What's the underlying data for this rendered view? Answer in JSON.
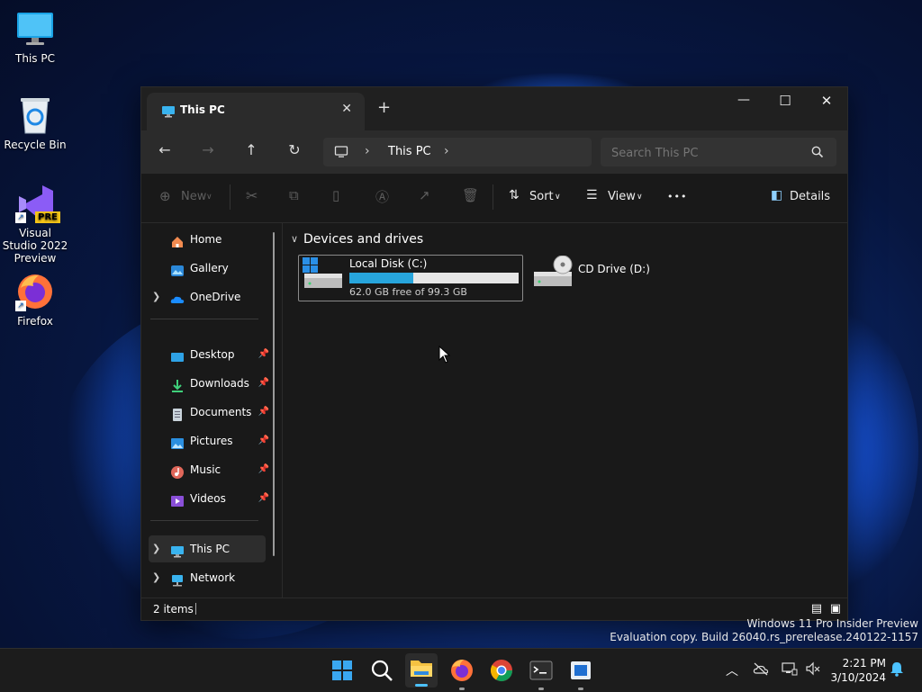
{
  "desktop": {
    "icons": [
      {
        "label": "This PC"
      },
      {
        "label": "Recycle Bin"
      },
      {
        "label": "Visual Studio 2022 Preview",
        "badge": "PRE"
      },
      {
        "label": "Firefox"
      }
    ]
  },
  "window": {
    "tab_title": "This PC",
    "tab_close": "✕",
    "new_tab": "+",
    "controls": {
      "minimize": "—",
      "maximize": "☐",
      "close": "✕"
    },
    "nav": {
      "back": "←",
      "forward": "→",
      "up": "↑",
      "refresh": "↻"
    },
    "breadcrumb": {
      "root_sep": "›",
      "current": "This PC",
      "trail_sep": "›"
    },
    "search": {
      "placeholder": "Search This PC",
      "icon": "search-icon"
    },
    "toolbar": {
      "new_label": "New",
      "sort_label": "Sort",
      "view_label": "View",
      "more_label": "•••",
      "details_label": "Details"
    },
    "nav_pane": {
      "items": [
        {
          "label": "Home",
          "icon": "home-icon"
        },
        {
          "label": "Gallery",
          "icon": "gallery-icon"
        },
        {
          "label": "OneDrive",
          "icon": "onedrive-icon",
          "expandable": true
        },
        {
          "label": "Desktop",
          "icon": "desktop-icon",
          "pinned": true
        },
        {
          "label": "Downloads",
          "icon": "downloads-icon",
          "pinned": true
        },
        {
          "label": "Documents",
          "icon": "documents-icon",
          "pinned": true
        },
        {
          "label": "Pictures",
          "icon": "pictures-icon",
          "pinned": true
        },
        {
          "label": "Music",
          "icon": "music-icon",
          "pinned": true
        },
        {
          "label": "Videos",
          "icon": "videos-icon",
          "pinned": true
        },
        {
          "label": "This PC",
          "icon": "this-pc-icon",
          "expandable": true,
          "selected": true
        },
        {
          "label": "Network",
          "icon": "network-icon",
          "expandable": true
        }
      ]
    },
    "content": {
      "group_title": "Devices and drives",
      "group_chevron": "∨",
      "drives": [
        {
          "name": "Local Disk (C:)",
          "free_text": "62.0 GB free of 99.3 GB",
          "used_fraction": 0.376
        },
        {
          "name": "CD Drive (D:)"
        }
      ]
    },
    "status": {
      "items_text": "2 items"
    }
  },
  "watermark": {
    "line1": "Windows 11 Pro Insider Preview",
    "line2": "Evaluation copy. Build 26040.rs_prerelease.240122-1157"
  },
  "taskbar": {
    "clock_time": "2:21 PM",
    "clock_date": "3/10/2024"
  },
  "colors": {
    "accent": "#4cc2ff",
    "drive_bar": "#27a5dc"
  }
}
